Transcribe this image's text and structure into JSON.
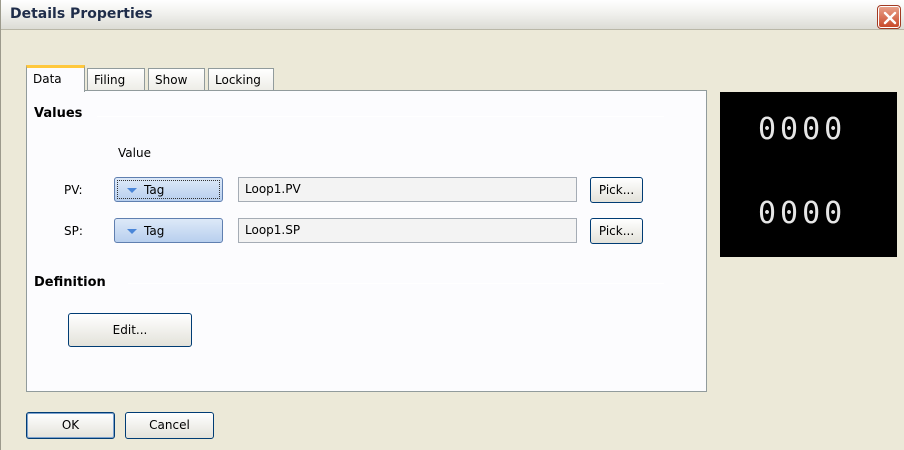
{
  "window": {
    "title": "Details Properties"
  },
  "tabs": [
    {
      "label": "Data",
      "active": true
    },
    {
      "label": "Filing",
      "active": false
    },
    {
      "label": "Show",
      "active": false
    },
    {
      "label": "Locking",
      "active": false
    }
  ],
  "values_group": {
    "title": "Values",
    "column_header": "Value",
    "rows": [
      {
        "label": "PV:",
        "source": "Tag",
        "value": "Loop1.PV",
        "pick_label": "Pick..."
      },
      {
        "label": "SP:",
        "source": "Tag",
        "value": "Loop1.SP",
        "pick_label": "Pick..."
      }
    ]
  },
  "definition_group": {
    "title": "Definition",
    "edit_label": "Edit..."
  },
  "buttons": {
    "ok": "OK",
    "cancel": "Cancel"
  },
  "preview": {
    "display_1": "0000",
    "display_2": "0000"
  },
  "colors": {
    "tab_highlight": "#ffc83c",
    "close_button": "#c94a2b",
    "preview_bg": "#000000"
  }
}
